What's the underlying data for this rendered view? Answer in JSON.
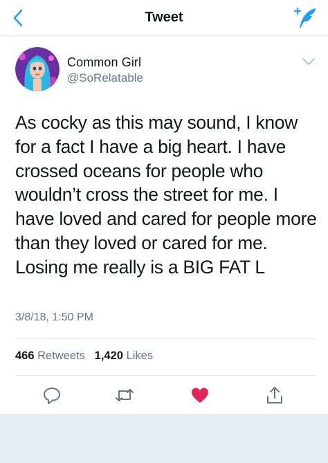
{
  "header": {
    "title": "Tweet",
    "back_icon": "chevron-left-icon",
    "compose_icon": "compose-tweet-icon",
    "accent_color": "#1da1f2"
  },
  "tweet": {
    "author": {
      "display_name": "Common Girl",
      "handle": "@SoRelatable"
    },
    "text": "As cocky as this may sound, I know for a fact I have a big heart. I have crossed oceans for people who wouldn’t cross the street for me. I have loved and cared for people more than they loved or cared for me. Losing me really is a BIG FAT L",
    "timestamp": "3/8/18, 1:50 PM",
    "stats": {
      "retweets_count": "466",
      "retweets_label": "Retweets",
      "likes_count": "1,420",
      "likes_label": "Likes"
    },
    "actions": {
      "reply_icon": "reply-icon",
      "retweet_icon": "retweet-icon",
      "like_icon": "heart-icon",
      "share_icon": "share-icon",
      "liked": true,
      "like_color": "#e0245e"
    }
  }
}
